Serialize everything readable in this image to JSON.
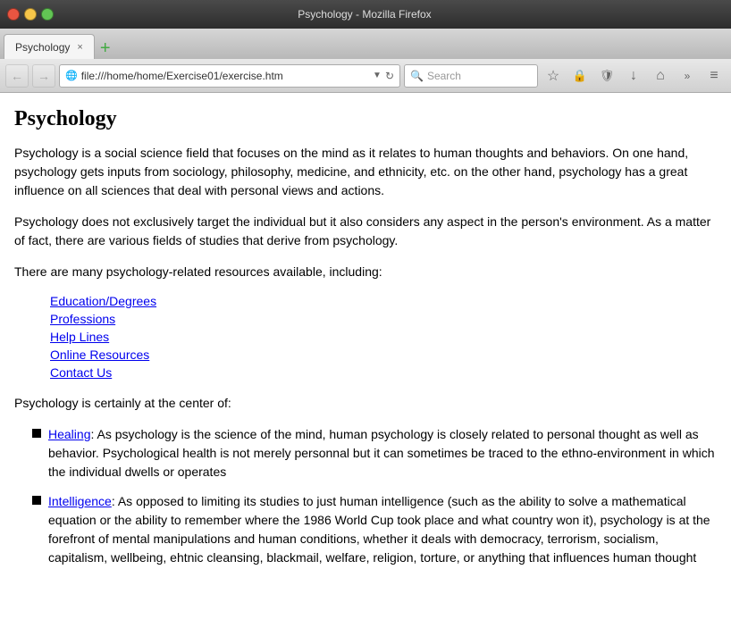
{
  "titlebar": {
    "title": "Psychology - Mozilla Firefox",
    "buttons": [
      "close",
      "minimize",
      "maximize"
    ]
  },
  "tab": {
    "label": "Psychology",
    "close_label": "×"
  },
  "new_tab_btn": "+",
  "navbar": {
    "back_tooltip": "Back",
    "forward_tooltip": "Forward",
    "address": "file:///home/home/Exercise01/exercise.htm",
    "reload": "↻",
    "search_placeholder": "Search",
    "bookmark_icon": "☆",
    "readonly_icon": "🔒",
    "shield_icon": "🛡",
    "download_icon": "↓",
    "home_icon": "⌂",
    "more_icon": "»",
    "menu_icon": "≡"
  },
  "page": {
    "title": "Psychology",
    "para1": "Psychology is a social science field that focuses on the mind as it relates to human thoughts and behaviors. On one hand, psychology gets inputs from sociology, philosophy, medicine, and ethnicity, etc. on the other hand, psychology has a great influence on all sciences that deal with personal views and actions.",
    "para2": "Psychology does not exclusively target the individual but it also considers any aspect in the person's environment. As a matter of fact, there are various fields of studies that derive from psychology.",
    "para3": "There are many psychology-related resources available, including:",
    "links": [
      {
        "text": "Education/Degrees",
        "href": "#"
      },
      {
        "text": "Professions",
        "href": "#"
      },
      {
        "text": "Help Lines",
        "href": "#"
      },
      {
        "text": "Online Resources",
        "href": "#"
      },
      {
        "text": "Contact Us",
        "href": "#"
      }
    ],
    "para4": "Psychology is certainly at the center of:",
    "bullets": [
      {
        "link_text": "Healing",
        "rest": ": As psychology is the science of the mind, human psychology is closely related to personal thought as well as behavior. Psychological health is not merely personnal but it can sometimes be traced to the ethno-environment in which the individual dwells or operates"
      },
      {
        "link_text": "Intelligence",
        "rest": ": As opposed to limiting its studies to just human intelligence (such as the ability to solve a mathematical equation or the ability to remember where the 1986 World Cup took place and what country won it), psychology is at the forefront of mental manipulations and human conditions, whether it deals with democracy, terrorism, socialism, capitalism, wellbeing, ehtnic cleansing, blackmail, welfare, religion, torture, or anything that influences human thought"
      }
    ]
  }
}
